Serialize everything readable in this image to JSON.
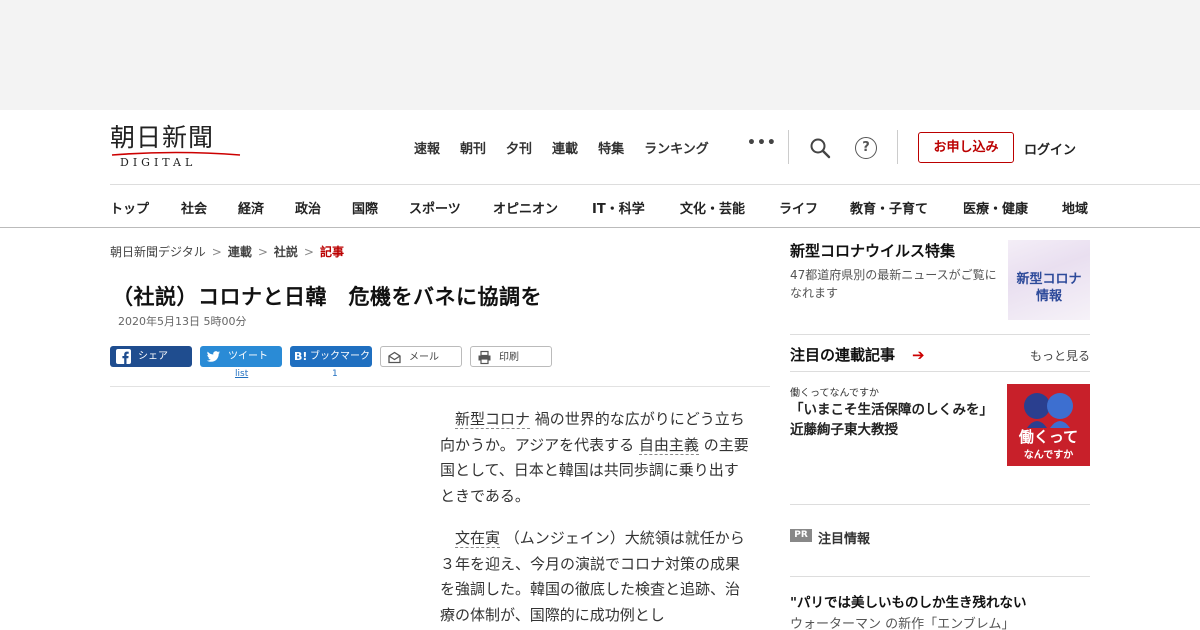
{
  "masthead": {
    "logo_kanji": "朝日新聞",
    "logo_roman": "DIGITAL",
    "topnav": [
      "速報",
      "朝刊",
      "夕刊",
      "連載",
      "特集",
      "ランキング"
    ],
    "more": "•••",
    "help": "?",
    "subscribe": "お申し込み",
    "login": "ログイン"
  },
  "catnav": [
    "トップ",
    "社会",
    "経済",
    "政治",
    "国際",
    "スポーツ",
    "オピニオン",
    "IT・科学",
    "文化・芸能",
    "ライフ",
    "教育・子育て",
    "医療・健康",
    "地域"
  ],
  "breadcrumb": [
    "朝日新聞デジタル",
    "連載",
    "社説",
    "記事"
  ],
  "article": {
    "headline": "（社説）コロナと日韓　危機をバネに協調を",
    "date": "2020年5月13日 5時00分",
    "share": {
      "facebook": "シェア",
      "twitter": "ツイート",
      "hatena": "ブックマーク",
      "hatena_mark": "B!",
      "mail": "メール",
      "print": "印刷",
      "twitter_count": "list",
      "hatena_count": "1"
    },
    "p1": {
      "kw1": "新型コロナ",
      "t1": "禍の世界的な広がりにどう立ち向かうか。アジアを代表する",
      "kw2": "自由主義",
      "t2": "の主要国として、日本と韓国は共同歩調に乗り出すときである。"
    },
    "p2": {
      "kw1": "文在寅",
      "t1": "（ムンジェイン）大統領は就任から３年を迎え、今月の演説でコロナ対策の成果を強調した。韓国の徹底した検査と追跡、治療の体制が、国際的に成功例とし"
    }
  },
  "sidebar": {
    "feature": {
      "title": "新型コロナウイルス特集",
      "desc": "47都道府県別の最新ニュースがご覧になれます",
      "thumb_line1": "新型コロナ",
      "thumb_line2": "情報"
    },
    "serial": {
      "title": "注目の連載記事",
      "arrow": "➔",
      "more": "もっと見る",
      "kicker": "働くってなんですか",
      "item_title": "「いまこそ生活保障のしくみを」　近藤絢子東大教授",
      "thumb_line1": "働くって",
      "thumb_line2": "なんですか"
    },
    "pr": {
      "badge": "PR",
      "label": "注目情報",
      "title": "\"パリでは美しいものしか生き残れない",
      "sub": "ウォーターマン の新作「エンブレム」"
    }
  },
  "colors": {
    "accent_red": "#b00000",
    "facebook": "#1f4d8f",
    "twitter": "#2a8bd6",
    "hatena": "#1f6fc0"
  }
}
